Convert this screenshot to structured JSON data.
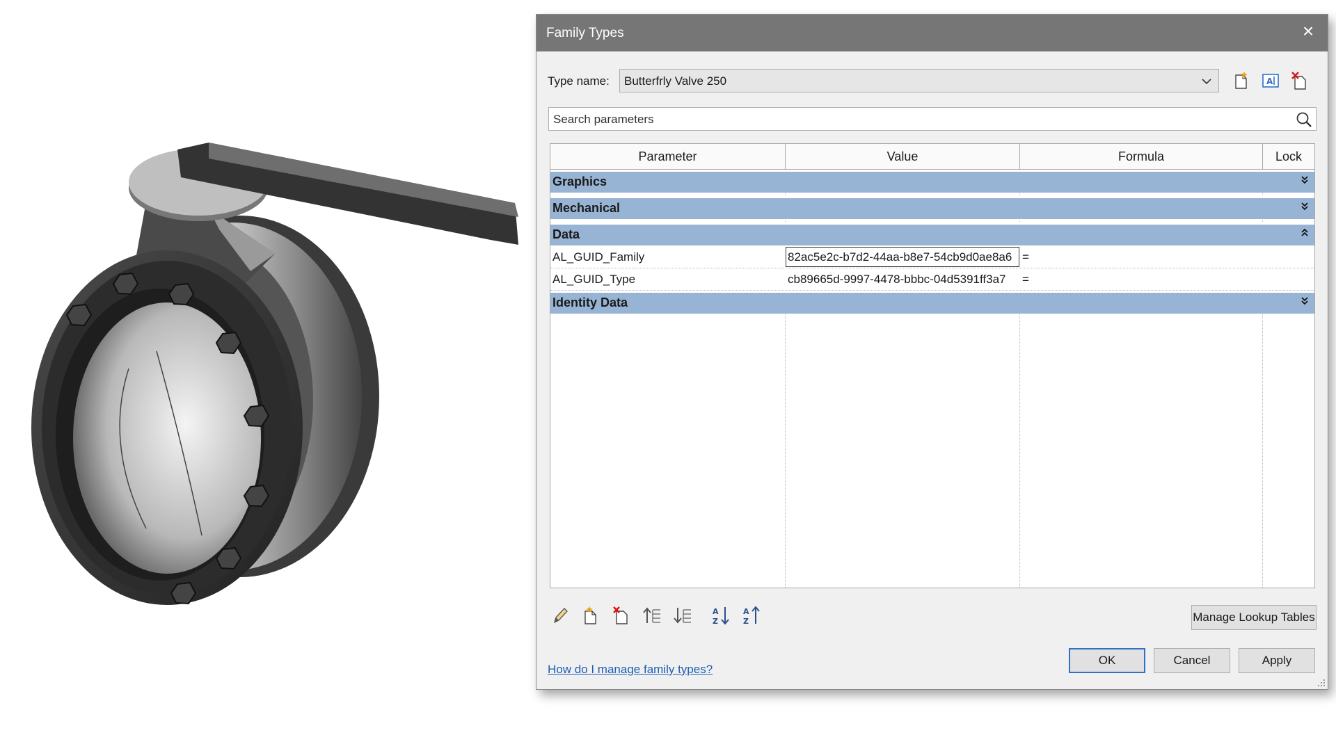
{
  "dialog": {
    "title": "Family Types",
    "close_glyph": "×",
    "type_name_label": "Type name:",
    "type_name_value": "Butterfrly Valve 250",
    "search_placeholder": "Search parameters",
    "columns": [
      "Parameter",
      "Value",
      "Formula",
      "Lock"
    ],
    "groups": [
      {
        "name": "Graphics",
        "expanded": false
      },
      {
        "name": "Mechanical",
        "expanded": false
      },
      {
        "name": "Data",
        "expanded": true
      },
      {
        "name": "Identity Data",
        "expanded": false
      }
    ],
    "data_rows": [
      {
        "parameter": "AL_GUID_Family",
        "value": "82ac5e2c-b7d2-44aa-b8e7-54cb9d0ae8a6",
        "formula": "="
      },
      {
        "parameter": "AL_GUID_Type",
        "value": "cb89665d-9997-4478-bbbc-04d5391ff3a7",
        "formula": "="
      }
    ],
    "toolbar_icons": [
      "edit-pencil-icon",
      "new-parameter-icon",
      "delete-parameter-icon",
      "move-up-icon",
      "move-down-icon",
      "sort-ascending-icon",
      "sort-descending-icon"
    ],
    "manage_lookup_label": "Manage Lookup Tables",
    "help_link": "How do I manage family types?",
    "ok_label": "OK",
    "cancel_label": "Cancel",
    "apply_label": "Apply"
  },
  "colors": {
    "titlebar": "#767676",
    "group_header": "#98b4d4",
    "dialog_bg": "#f0f0f0",
    "link": "#1a5fb4",
    "ok_border": "#2f6fc8"
  }
}
